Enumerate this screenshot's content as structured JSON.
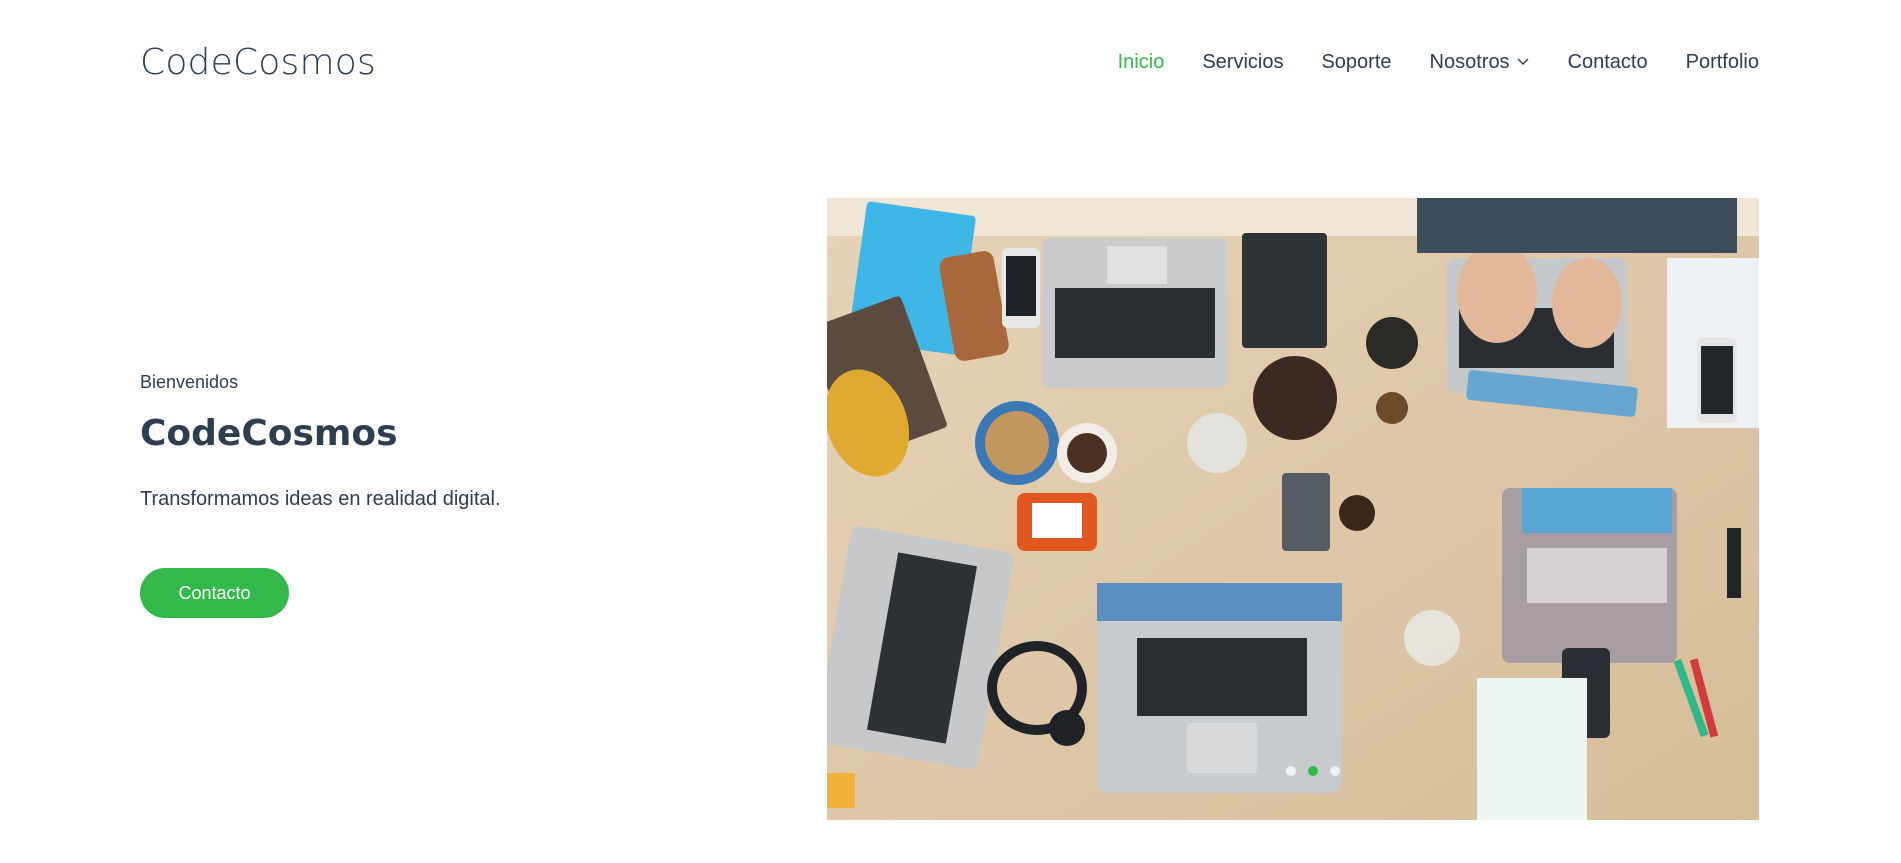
{
  "brand": {
    "name": "CodeCosmos"
  },
  "nav": {
    "items": [
      {
        "label": "Inicio",
        "active": true
      },
      {
        "label": "Servicios"
      },
      {
        "label": "Soporte"
      },
      {
        "label": "Nosotros",
        "dropdown": true
      },
      {
        "label": "Contacto"
      },
      {
        "label": "Portfolio"
      }
    ]
  },
  "hero": {
    "eyebrow": "Bienvenidos",
    "title": "CodeCosmos",
    "subtitle": "Transformamos ideas en realidad digital.",
    "cta_label": "Contacto",
    "carousel": {
      "slides": 3,
      "active_index": 1
    }
  },
  "colors": {
    "accent": "#33b94a",
    "text": "#2d3e50",
    "background": "#ffffff"
  },
  "icons": {
    "dropdown": "chevron-down-icon"
  }
}
